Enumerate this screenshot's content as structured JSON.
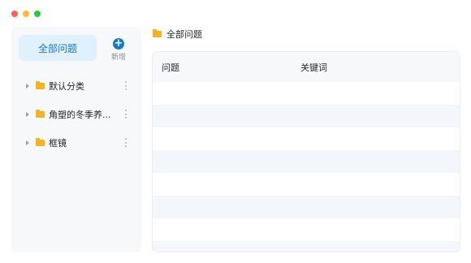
{
  "sidebar": {
    "all_questions_label": "全部问题",
    "add_label": "新增",
    "add_symbol": "+",
    "items": [
      {
        "label": "默认分类"
      },
      {
        "label": "角塑的冬季养..."
      },
      {
        "label": "框镜"
      }
    ]
  },
  "breadcrumb": {
    "label": "全部问题"
  },
  "table": {
    "columns": [
      "问题",
      "关键词"
    ],
    "rows": []
  },
  "colors": {
    "accent": "#1677d2",
    "folder": "#f5b324",
    "close": "#ff5f57",
    "minimize": "#febc2e",
    "maximize": "#28c840"
  }
}
